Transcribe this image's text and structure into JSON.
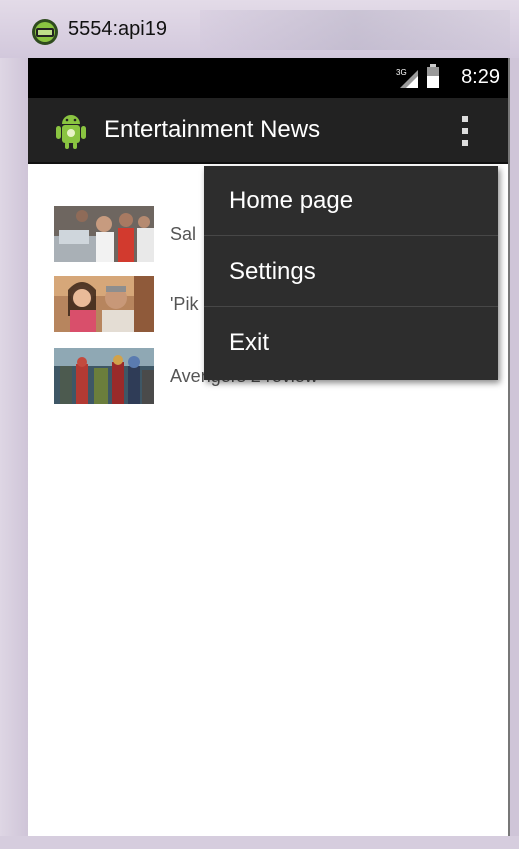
{
  "window": {
    "title": "5554:api19"
  },
  "status_bar": {
    "signal_label": "3G",
    "time": "8:29"
  },
  "action_bar": {
    "title": "Entertainment News"
  },
  "news_list": [
    {
      "title": "Sal",
      "thumb": "crowd-photo"
    },
    {
      "title": "'Pik",
      "thumb": "couple-photo"
    },
    {
      "title": "Avengers 2 review",
      "thumb": "avengers-photo"
    }
  ],
  "menu": {
    "items": [
      {
        "label": "Home page"
      },
      {
        "label": "Settings"
      },
      {
        "label": "Exit"
      }
    ]
  },
  "colors": {
    "action_bar": "#222222",
    "menu_bg": "#2d2d2d",
    "android_green": "#8ac441"
  }
}
